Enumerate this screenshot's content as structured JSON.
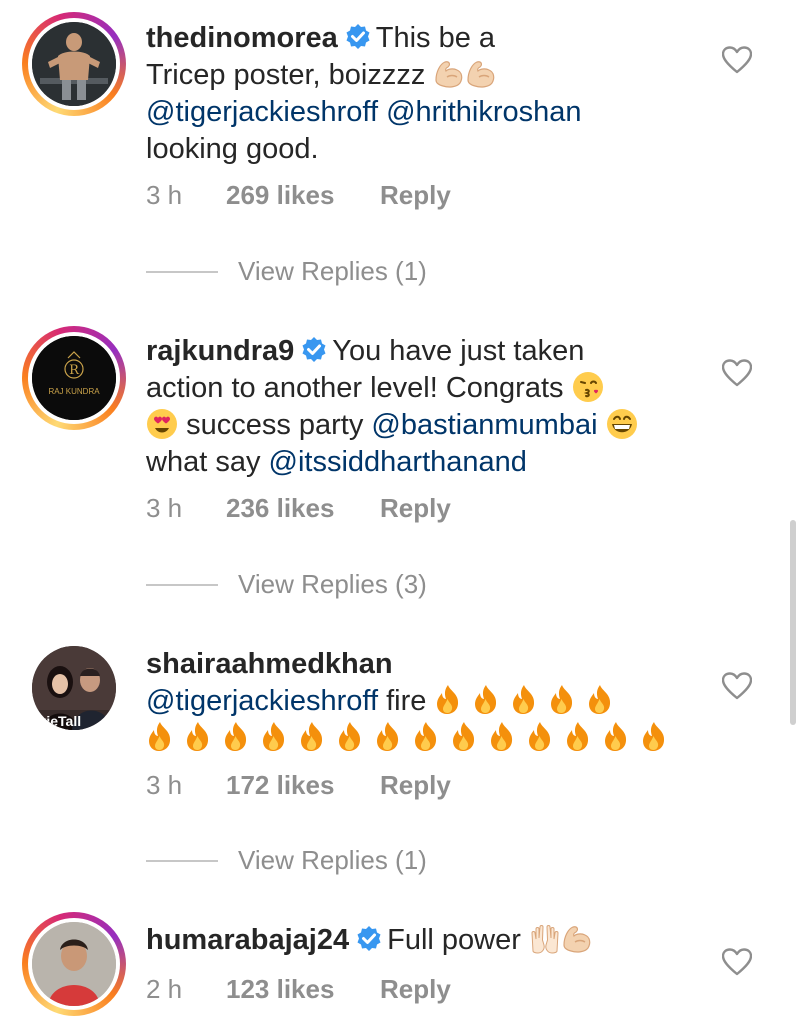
{
  "comments": [
    {
      "username": "thedinomorea",
      "verified": true,
      "text_1": "This be a",
      "text_2": "Tricep poster, boizzzz",
      "emoji_a": "muscle-emoji",
      "mention_1": "@tigerjackieshroff",
      "mention_2": "@hrithikroshan",
      "text_3": "looking good.",
      "time": "3 h",
      "likes": "269 likes",
      "reply": "Reply",
      "view_replies": "View Replies (1)"
    },
    {
      "username": "rajkundra9",
      "verified": true,
      "avatar_text": "RAJ KUNDRA",
      "avatar_letter": "R",
      "text_1": "You have just taken",
      "text_2": "action to another level! Congrats",
      "text_3": "success party",
      "mention_1": "@bastianmumbai",
      "text_4": "what say",
      "mention_2": "@itssiddharthanand",
      "time": "3 h",
      "likes": "236 likes",
      "reply": "Reply",
      "view_replies": "View Replies (3)"
    },
    {
      "username": "shairaahmedkhan",
      "verified": false,
      "avatar_text": "ovieTall",
      "mention_1": "@tigerjackieshroff",
      "text_1": "fire",
      "time": "3 h",
      "likes": "172 likes",
      "reply": "Reply",
      "view_replies": "View Replies (1)"
    },
    {
      "username": "humarabajaj24",
      "verified": true,
      "text_1": "Full power",
      "time": "2 h",
      "likes": "123 likes",
      "reply": "Reply"
    }
  ],
  "icons": {
    "verified": "verified-badge-icon",
    "heart": "heart-icon",
    "fire": "fire-emoji",
    "muscle": "muscle-emoji"
  },
  "colors": {
    "text": "#262626",
    "mention": "#003569",
    "meta": "#8e8e8e",
    "verified": "#3897f0",
    "fire": "#f4900c"
  }
}
